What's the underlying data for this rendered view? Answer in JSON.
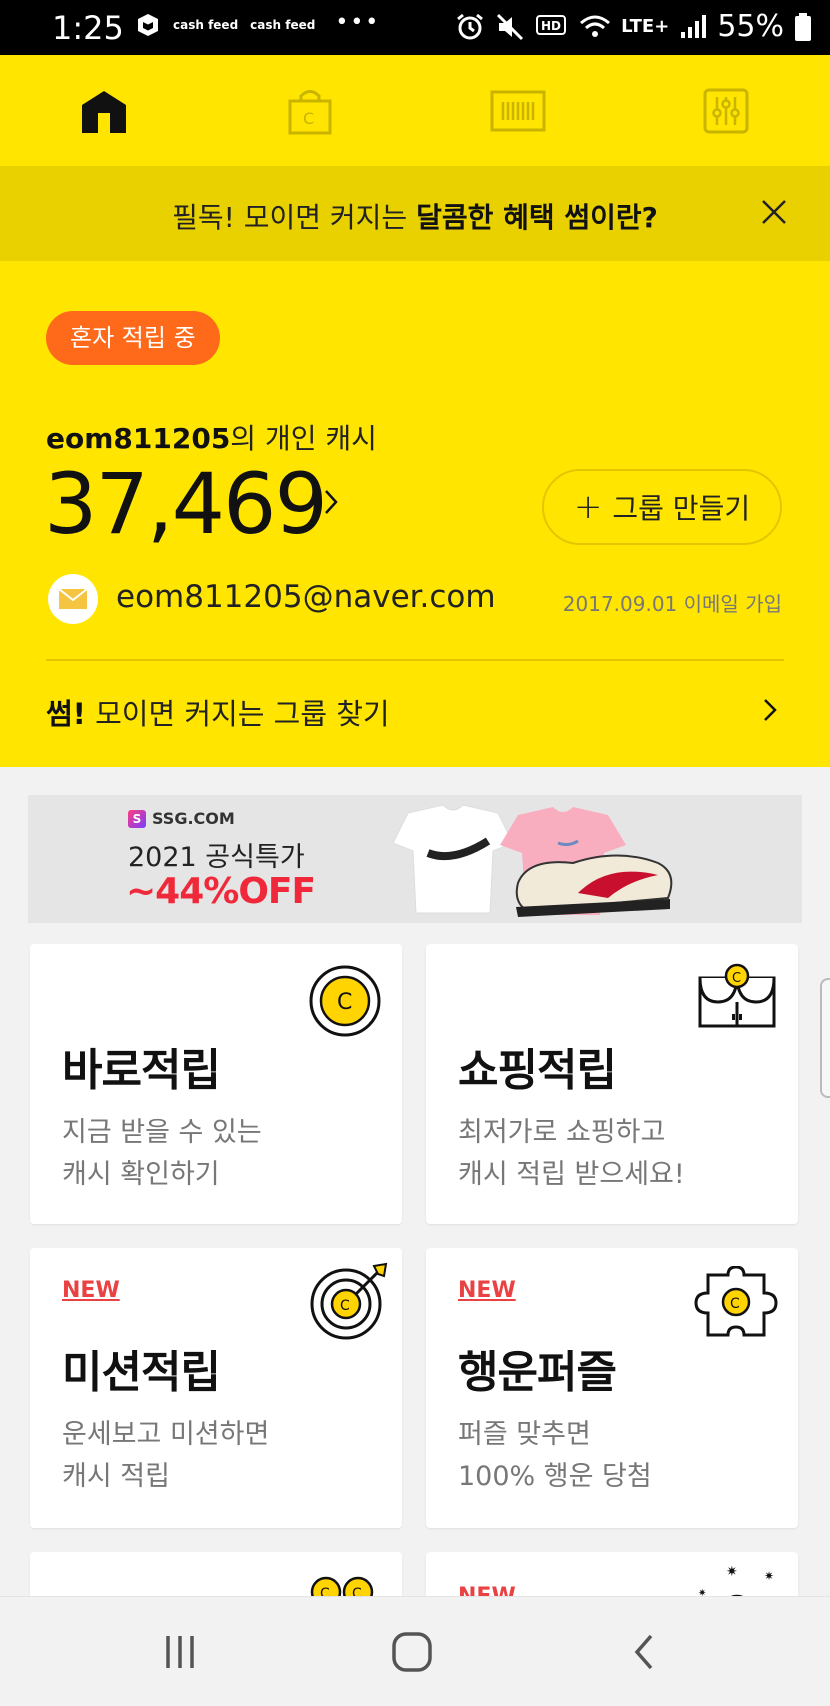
{
  "status_bar": {
    "time": "1:25",
    "cashfeed_1": "cash feed",
    "cashfeed_2": "cash feed",
    "more": "•••",
    "network": "LTE+",
    "battery": "55%"
  },
  "top_nav": [
    {
      "name": "home-icon",
      "active": true
    },
    {
      "name": "shopping-bag-icon",
      "active": false
    },
    {
      "name": "barcode-icon",
      "active": false
    },
    {
      "name": "settings-sliders-icon",
      "active": false
    }
  ],
  "banner": {
    "text_normal": "필독! 모이면 커지는 ",
    "text_bold": "달콤한 혜택 썸이란?",
    "close_icon": "close-icon"
  },
  "account": {
    "status_pill": "혼자 적립 중",
    "user_id": "eom811205",
    "cash_label_suffix": "의 개인 캐시",
    "cash_amount": "37,469",
    "group_button": "그룹 만들기",
    "group_button_icon": "+",
    "email": "eom811205@naver.com",
    "joined": "2017.09.01 이메일 가입",
    "find_group_bold": "썸!",
    "find_group_text": " 모이면 커지는 그룹 찾기"
  },
  "ad": {
    "brand": "SSG.COM",
    "brand_logo": "S",
    "title": "2021 공식특가",
    "discount": "~44%OFF"
  },
  "cards": [
    {
      "new": "",
      "title": "바로적립",
      "desc": [
        "지금 받을 수 있는",
        "캐시 확인하기"
      ],
      "icon": "coin-icon"
    },
    {
      "new": "",
      "title": "쇼핑적립",
      "desc": [
        "최저가로 쇼핑하고",
        "캐시 적립 받으세요!"
      ],
      "icon": "store-coin-icon"
    },
    {
      "new": "NEW",
      "title": "미션적립",
      "desc": [
        "운세보고 미션하면",
        "캐시 적립"
      ],
      "icon": "target-icon"
    },
    {
      "new": "NEW",
      "title": "행운퍼즐",
      "desc": [
        "퍼즐 맞추면",
        "100% 행운 당첨"
      ],
      "icon": "puzzle-icon"
    }
  ],
  "partial_cards": [
    {
      "new": "",
      "icon": "coins-icon"
    },
    {
      "new": "NEW",
      "icon": "sparkle-icon"
    }
  ],
  "colors": {
    "brand_yellow": "#ffe500",
    "banner_yellow": "#e9d100",
    "pill_orange": "#ff6a1a",
    "new_red": "#ea4242",
    "ad_red": "#f0293a"
  },
  "system_nav": [
    "recent-apps-icon",
    "home-circle-icon",
    "back-icon"
  ]
}
